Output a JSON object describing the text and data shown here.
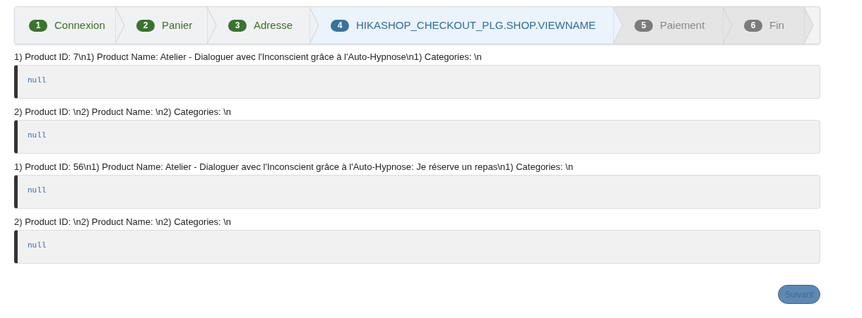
{
  "steps": [
    {
      "number": "1",
      "label": "Connexion",
      "completed": true,
      "selected": false
    },
    {
      "number": "2",
      "label": "Panier",
      "completed": true,
      "selected": false
    },
    {
      "number": "3",
      "label": "Adresse",
      "completed": true,
      "selected": false
    },
    {
      "number": "4",
      "label": "HIKASHOP_CHECKOUT_PLG.SHOP.VIEWNAME",
      "completed": false,
      "selected": true
    },
    {
      "number": "5",
      "label": "Paiement",
      "completed": false,
      "selected": false
    },
    {
      "number": "6",
      "label": "Fin",
      "completed": false,
      "selected": false
    }
  ],
  "entries": [
    {
      "label": "1) Product ID: 7\\n1) Product Name: Atelier - Dialoguer avec l'Inconscient grâce à l'Auto-Hypnose\\n1) Categories: \\n",
      "code": "null"
    },
    {
      "label": "2) Product ID: \\n2) Product Name: \\n2) Categories: \\n",
      "code": "null"
    },
    {
      "label": "1) Product ID: 56\\n1) Product Name: Atelier - Dialoguer avec l'Inconscient grâce à l'Auto-Hypnose: Je réserve un repas\\n1) Categories: \\n",
      "code": "null"
    },
    {
      "label": "2) Product ID: \\n2) Product Name: \\n2) Categories: \\n",
      "code": "null"
    }
  ],
  "next_button": "Suivant"
}
